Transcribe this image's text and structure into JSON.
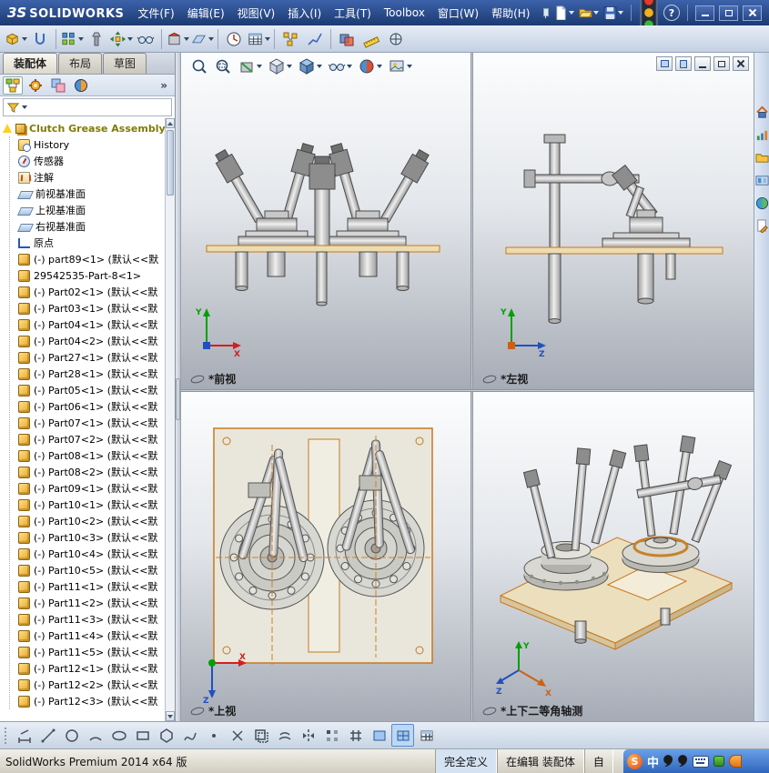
{
  "window": {
    "logo_mark": "3S",
    "logo_text": "SOLIDWORKS",
    "menus": [
      "文件(F)",
      "编辑(E)",
      "视图(V)",
      "插入(I)",
      "工具(T)",
      "Toolbox",
      "窗口(W)",
      "帮助(H)"
    ],
    "help_glyph": "?",
    "titlebar_icons": [
      "new-document",
      "open",
      "save",
      "traffic-light",
      "help",
      "minimize",
      "restore",
      "close"
    ]
  },
  "mode_tabs": [
    {
      "label": "装配体",
      "active": true
    },
    {
      "label": "布局",
      "active": false
    },
    {
      "label": "草图",
      "active": false
    }
  ],
  "panel_expand": "»",
  "manager_tabs_icons": [
    "featuremanager-tree",
    "propertymanager",
    "configurationmanager",
    "displaymanager"
  ],
  "assembly_toolbar_icons": [
    "insert-components",
    "mate",
    "linear-component-pattern",
    "smart-fasteners",
    "move-component",
    "show-hidden-components",
    "assembly-features",
    "reference-geometry",
    "new-motion-study",
    "bill-of-materials",
    "exploded-view",
    "explode-line-sketch",
    "interference-detection",
    "measure",
    "mass-properties"
  ],
  "hud_icons": [
    "zoom-fit",
    "zoom-area",
    "section-view",
    "view-orientation",
    "display-style",
    "hide-show-items",
    "edit-appearance",
    "view-settings"
  ],
  "taskpane_icons": [
    "resources",
    "design-library",
    "file-explorer",
    "view-palette",
    "appearances",
    "custom-properties"
  ],
  "sketch_toolbar_icons": [
    "smart-dimension",
    "line",
    "circle",
    "arc",
    "ellipse",
    "rectangle",
    "polygon",
    "spline",
    "point",
    "trim-entities",
    "convert-entities",
    "offset-entities",
    "mirror-entities",
    "linear-sketch-pattern",
    "grid",
    "single-view",
    "four-view",
    "table"
  ],
  "tree": {
    "root": {
      "label": "Clutch Grease Assembly",
      "icon": "assembly-warning"
    },
    "items": [
      {
        "label": "History",
        "icon": "history"
      },
      {
        "label": "传感器",
        "icon": "sensor"
      },
      {
        "label": "注解",
        "icon": "annotation"
      },
      {
        "label": "前视基准面",
        "icon": "plane"
      },
      {
        "label": "上视基准面",
        "icon": "plane"
      },
      {
        "label": "右视基准面",
        "icon": "plane"
      },
      {
        "label": "原点",
        "icon": "origin"
      },
      {
        "label": "(-) part89<1> (默认<<默",
        "icon": "part"
      },
      {
        "label": "29542535-Part-8<1>",
        "icon": "part"
      },
      {
        "label": "(-) Part02<1> (默认<<默",
        "icon": "part"
      },
      {
        "label": "(-) Part03<1> (默认<<默",
        "icon": "part"
      },
      {
        "label": "(-) Part04<1> (默认<<默",
        "icon": "part"
      },
      {
        "label": "(-) Part04<2> (默认<<默",
        "icon": "part"
      },
      {
        "label": "(-) Part27<1> (默认<<默",
        "icon": "part"
      },
      {
        "label": "(-) Part28<1> (默认<<默",
        "icon": "part"
      },
      {
        "label": "(-) Part05<1> (默认<<默",
        "icon": "part"
      },
      {
        "label": "(-) Part06<1> (默认<<默",
        "icon": "part"
      },
      {
        "label": "(-) Part07<1> (默认<<默",
        "icon": "part"
      },
      {
        "label": "(-) Part07<2> (默认<<默",
        "icon": "part"
      },
      {
        "label": "(-) Part08<1> (默认<<默",
        "icon": "part"
      },
      {
        "label": "(-) Part08<2> (默认<<默",
        "icon": "part"
      },
      {
        "label": "(-) Part09<1> (默认<<默",
        "icon": "part"
      },
      {
        "label": "(-) Part10<1> (默认<<默",
        "icon": "part"
      },
      {
        "label": "(-) Part10<2> (默认<<默",
        "icon": "part"
      },
      {
        "label": "(-) Part10<3> (默认<<默",
        "icon": "part"
      },
      {
        "label": "(-) Part10<4> (默认<<默",
        "icon": "part"
      },
      {
        "label": "(-) Part10<5> (默认<<默",
        "icon": "part"
      },
      {
        "label": "(-) Part11<1> (默认<<默",
        "icon": "part"
      },
      {
        "label": "(-) Part11<2> (默认<<默",
        "icon": "part"
      },
      {
        "label": "(-) Part11<3> (默认<<默",
        "icon": "part"
      },
      {
        "label": "(-) Part11<4> (默认<<默",
        "icon": "part"
      },
      {
        "label": "(-) Part11<5> (默认<<默",
        "icon": "part"
      },
      {
        "label": "(-) Part12<1> (默认<<默",
        "icon": "part"
      },
      {
        "label": "(-) Part12<2> (默认<<默",
        "icon": "part"
      },
      {
        "label": "(-) Part12<3> (默认<<默",
        "icon": "part"
      }
    ]
  },
  "viewports": {
    "front": {
      "label": "*前视"
    },
    "left": {
      "label": "*左视"
    },
    "top": {
      "label": "*上视"
    },
    "iso": {
      "label": "*上下二等角轴测"
    }
  },
  "triad": {
    "x": "X",
    "y": "Y",
    "z": "Z"
  },
  "statusbar": {
    "product": "SolidWorks Premium 2014 x64 版",
    "defined": "完全定义",
    "editing": "在编辑 装配体",
    "custom": "自"
  },
  "ime": {
    "sogou": "S",
    "lang": "中"
  }
}
